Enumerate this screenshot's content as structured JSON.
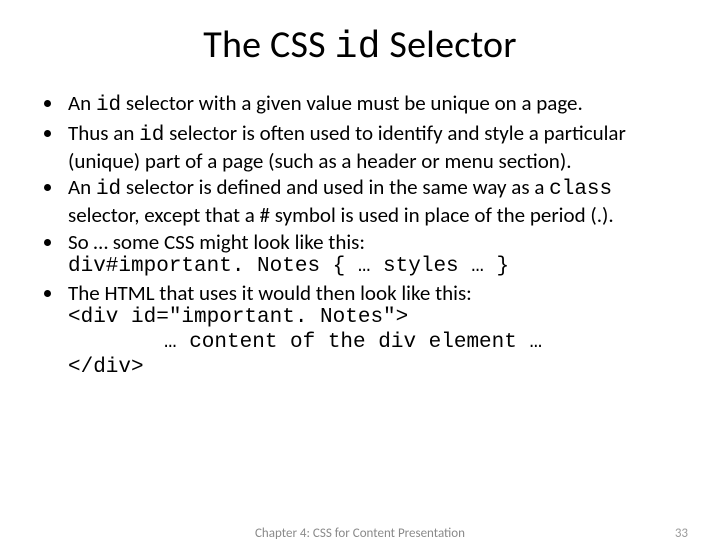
{
  "title_pre": "The CSS ",
  "title_code": "id",
  "title_post": " Selector",
  "bullets": {
    "b1_pre": "An ",
    "b1_code": "id",
    "b1_post": " selector with a given value must be unique on a page.",
    "b2_pre": "Thus an ",
    "b2_code": "id",
    "b2_post": " selector is often used to identify and style a particular (unique) part of a page (such as a header or menu section).",
    "b3_pre": "An ",
    "b3_code1": "id",
    "b3_mid": " selector is defined and used in the same way as a ",
    "b3_code2": "class",
    "b3_post": " selector, except that a # symbol is used in place of the period (.).",
    "b4_text": "So … some CSS might look like this:",
    "b4_code": "div#important. Notes { … styles … }",
    "b5_text": "The HTML that uses it would then look like this:",
    "b5_code1": "<div id=\"important. Notes\">",
    "b5_code2": "… content of the div element …",
    "b5_code3": "</div>"
  },
  "footer_center": "Chapter 4: CSS for Content Presentation",
  "footer_right": "33"
}
